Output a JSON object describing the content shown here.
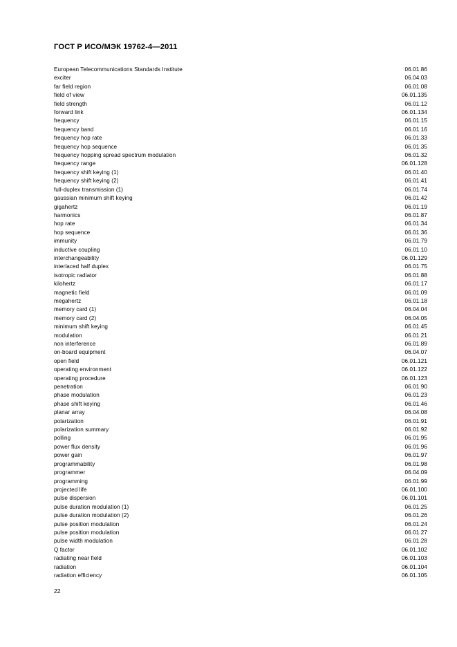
{
  "document": {
    "header": "ГОСТ Р ИСО/МЭК 19762-4—2011",
    "page_number": "22"
  },
  "index": {
    "entries": [
      {
        "term": "European Telecommunications Standards Institute",
        "code": "06.01.86"
      },
      {
        "term": "exciter",
        "code": "06.04.03"
      },
      {
        "term": "far field region",
        "code": "06.01.08"
      },
      {
        "term": "field of view",
        "code": "06.01.135"
      },
      {
        "term": "field strength",
        "code": "06.01.12"
      },
      {
        "term": "forward link",
        "code": "06.01.134"
      },
      {
        "term": "frequency",
        "code": "06.01.15"
      },
      {
        "term": "frequency band",
        "code": "06.01.16"
      },
      {
        "term": "frequency hop rate",
        "code": "06.01.33"
      },
      {
        "term": "frequency hop sequence",
        "code": "06.01.35"
      },
      {
        "term": "frequency hopping spread spectrum modulation",
        "code": "06.01.32"
      },
      {
        "term": "frequency range",
        "code": "06.01.128"
      },
      {
        "term": "frequency shift keying (1)",
        "code": "06.01.40"
      },
      {
        "term": "frequency shift keying (2)",
        "code": "06.01.41"
      },
      {
        "term": "full-duplex transmission (1)",
        "code": "06.01.74"
      },
      {
        "term": "gaussian minimum shift keying",
        "code": "06.01.42"
      },
      {
        "term": "gigahertz",
        "code": "06.01.19"
      },
      {
        "term": "harmonics",
        "code": "06.01.87"
      },
      {
        "term": "hop rate",
        "code": "06.01.34"
      },
      {
        "term": "hop sequence",
        "code": "06.01.36"
      },
      {
        "term": "immunity",
        "code": "06.01.79"
      },
      {
        "term": "inductive coupling",
        "code": "06.01.10"
      },
      {
        "term": "interchangeability",
        "code": "06.01.129"
      },
      {
        "term": "interlaced half duplex",
        "code": "06.01.75"
      },
      {
        "term": "isotropic radiator",
        "code": "06.01.88"
      },
      {
        "term": "kilohertz",
        "code": "06.01.17"
      },
      {
        "term": "magnetic field",
        "code": "06.01.09"
      },
      {
        "term": "megahertz",
        "code": "06.01.18"
      },
      {
        "term": "memory card (1)",
        "code": "06.04.04"
      },
      {
        "term": "memory card (2)",
        "code": "06.04.05"
      },
      {
        "term": "minimum shift keying",
        "code": "06.01.45"
      },
      {
        "term": "modulation",
        "code": "06.01.21"
      },
      {
        "term": "non interference",
        "code": "06.01.89"
      },
      {
        "term": "on-board equipment",
        "code": "06.04.07"
      },
      {
        "term": "open field",
        "code": "06.01.121"
      },
      {
        "term": "operating environment",
        "code": "06.01.122"
      },
      {
        "term": "operating procedure",
        "code": "06.01.123"
      },
      {
        "term": "penetration",
        "code": "06.01.90"
      },
      {
        "term": "phase modulation",
        "code": "06.01.23"
      },
      {
        "term": "phase shift keying",
        "code": "06.01.46"
      },
      {
        "term": "planar array",
        "code": "06.04.08"
      },
      {
        "term": "polarization",
        "code": "06.01.91"
      },
      {
        "term": "polarization summary",
        "code": "06.01.92"
      },
      {
        "term": "polling",
        "code": "06.01.95"
      },
      {
        "term": "power flux density",
        "code": "06.01.96"
      },
      {
        "term": "power gain",
        "code": "06.01.97"
      },
      {
        "term": "programmability",
        "code": "06.01.98"
      },
      {
        "term": "programmer",
        "code": "06.04.09"
      },
      {
        "term": "programming",
        "code": "06.01.99"
      },
      {
        "term": "projected life",
        "code": "06.01.100"
      },
      {
        "term": "pulse dispersion",
        "code": "06.01.101"
      },
      {
        "term": "pulse duration modulation (1)",
        "code": "06.01.25"
      },
      {
        "term": "pulse duration modulation (2)",
        "code": "06.01.26"
      },
      {
        "term": "pulse position modulation",
        "code": "06.01.24"
      },
      {
        "term": "pulse position modulation",
        "code": "06.01.27"
      },
      {
        "term": "pulse width modulation",
        "code": "06.01.28"
      },
      {
        "term": "Q factor",
        "code": "06.01.102"
      },
      {
        "term": "radiating near field",
        "code": "06.01.103"
      },
      {
        "term": "radiation",
        "code": "06.01.104"
      },
      {
        "term": "radiation efficiency",
        "code": "06.01.105"
      }
    ]
  }
}
